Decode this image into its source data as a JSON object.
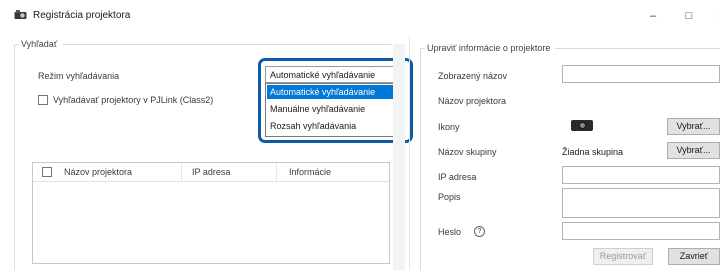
{
  "window": {
    "title": "Registrácia projektora",
    "icon": "projector-app-icon",
    "controls": {
      "minimize": "–",
      "maximize": "□",
      "close": "✕"
    }
  },
  "search": {
    "legend": "Vyhľadať",
    "mode_label": "Režim vyhľadávania",
    "mode_value": "Automatické vyhľadávanie",
    "pjlink_label": "Vyhľadávať projektory v PJLink (Class2)",
    "pjlink_checked": false,
    "dropdown_options": [
      "Automatické vyhľadávanie",
      "Manuálne vyhľadávanie",
      "Rozsah vyhľadávania"
    ],
    "selected_option_index": 0
  },
  "table": {
    "columns": [
      "Názov projektora",
      "IP adresa",
      "Informácie"
    ],
    "rows": []
  },
  "edit": {
    "legend": "Upraviť informácie o projektore",
    "display_name_label": "Zobrazený názov",
    "display_name_value": "",
    "projector_name_label": "Názov projektora",
    "projector_name_value": "",
    "icons_label": "Ikony",
    "select_button": "Vybrať...",
    "group_label": "Názov skupiny",
    "group_value": "Žiadna skupina",
    "ip_label": "IP adresa",
    "ip_value": "",
    "description_label": "Popis",
    "description_value": "",
    "password_label": "Heslo",
    "password_value": ""
  },
  "footer": {
    "register_button": "Registrovať",
    "close_button": "Zavrieť"
  },
  "colors": {
    "highlight": "#0d5aa7",
    "selected_item": "#0078d7"
  }
}
